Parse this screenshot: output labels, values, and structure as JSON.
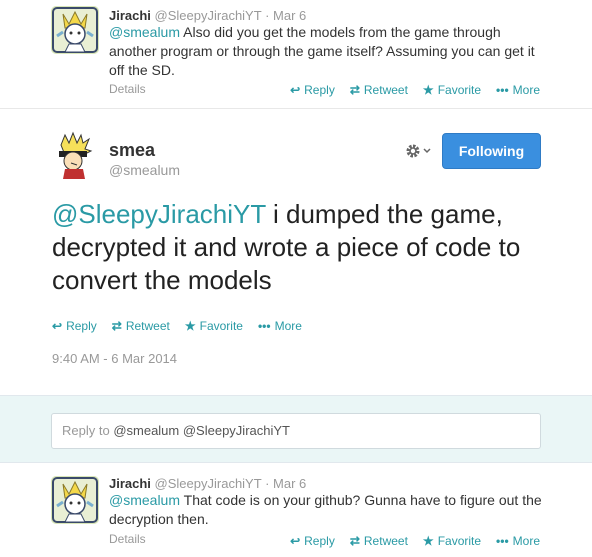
{
  "tweet1": {
    "fullname": "Jirachi",
    "username": "@SleepyJirachiYT",
    "dot": "·",
    "time": "Mar 6",
    "mention": "@smealum",
    "text": " Also did you get the models from the game through another program or through the game itself? Assuming you can get it off the SD.",
    "details": "Details"
  },
  "main_tweet": {
    "fullname": "smea",
    "username": "@smealum",
    "follow_label": "Following",
    "mention": "@SleepyJirachiYT",
    "text": " i dumped the game, decrypted it and wrote a piece of code to convert the models",
    "timestamp": "9:40 AM - 6 Mar 2014"
  },
  "reply_box": {
    "prefix": "Reply to ",
    "mentions": "@smealum @SleepyJirachiYT"
  },
  "tweet2": {
    "fullname": "Jirachi",
    "username": "@SleepyJirachiYT",
    "dot": "·",
    "time": "Mar 6",
    "mention": "@smealum",
    "text": " That code is on your github? Gunna have to figure out the decryption then.",
    "details": "Details"
  },
  "actions": {
    "reply": "Reply",
    "retweet": "Retweet",
    "favorite": "Favorite",
    "more": "More"
  },
  "icons": {
    "reply": "reply-arrow-icon",
    "retweet": "retweet-icon",
    "favorite": "star-icon",
    "more": "ellipsis-icon",
    "gear": "gear-icon"
  },
  "colors": {
    "link": "#2a9aa5",
    "follow_button": "#3a8fdf",
    "reply_bg": "#eaf6f6"
  }
}
